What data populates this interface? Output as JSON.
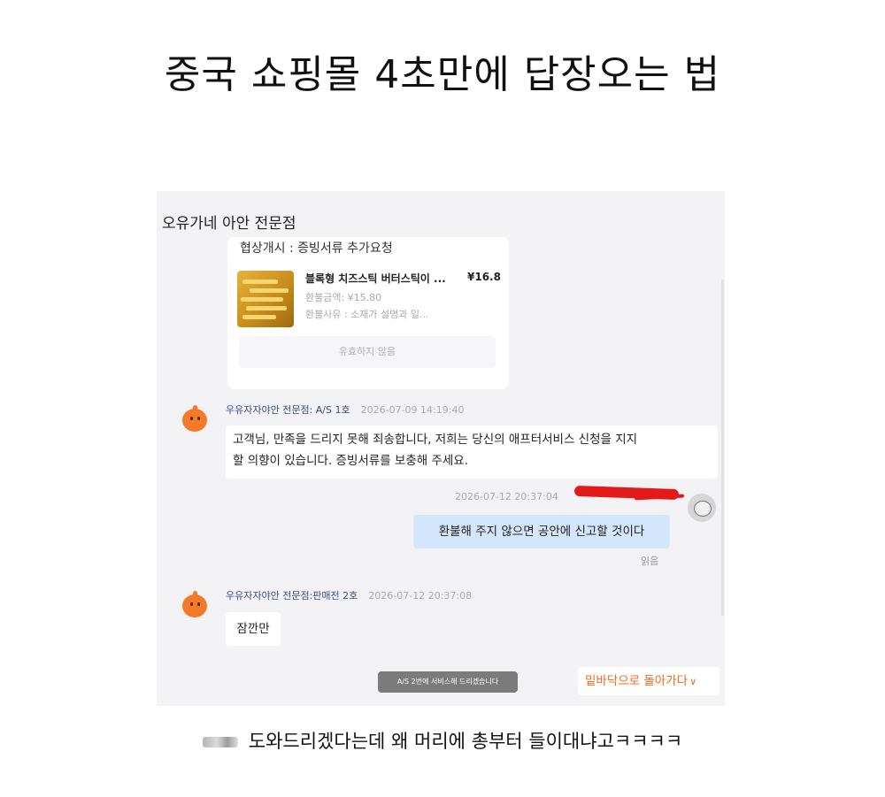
{
  "post": {
    "title": "중국 쇼핑몰 4초만에 답장오는 법",
    "caption": "도와드리겠다는데 왜 머리에 총부터 들이대냐고ㅋㅋㅋㅋ"
  },
  "chat": {
    "shop_name": "오유가네 아안 전문점",
    "refund_card": {
      "title": "협상개시 : 증빙서류 추가요청",
      "product_name": "블록형 치즈스틱 버터스틱이 ...",
      "product_price": "¥16.8",
      "refund_amount": "환불금액: ¥15.80",
      "refund_reason": "환불사유 : 소재가 설명과 일...",
      "button_label": "유효하지 않음"
    },
    "messages": [
      {
        "sender": "우유자자야안 전문점: A/S 1호",
        "time": "2026-07-09 14:19:40",
        "text_line1": "고객님, 만족을 드리지 못해 죄송합니다, 저희는 당신의 애프터서비스 신청을 지지",
        "text_line2": "할 의향이 있습니다. 증빙서류를 보충해 주세요."
      },
      {
        "time": "2026-07-12 20:37:04",
        "text": "환불해 주지 않으면 공안에 신고할 것이다",
        "status": "읽음"
      },
      {
        "sender": "우유자자야안 전문점:판매전 2호",
        "time": "2026-07-12 20:37:08",
        "text": "잠깐만"
      }
    ],
    "toast": "A/S 2번에 서비스해 드리겠습니다",
    "scroll_bottom_label": "밑바닥으로 돌아가다"
  },
  "colors": {
    "user_bubble": "#d4e6fb",
    "seller_avatar": "#f47a2a",
    "scroll_label": "#ef6a1c",
    "redaction": "#e21a1a"
  },
  "icons": [
    "seller-mascot-icon",
    "user-avatar-icon",
    "chevron-down-icon",
    "product-thumbnail"
  ]
}
